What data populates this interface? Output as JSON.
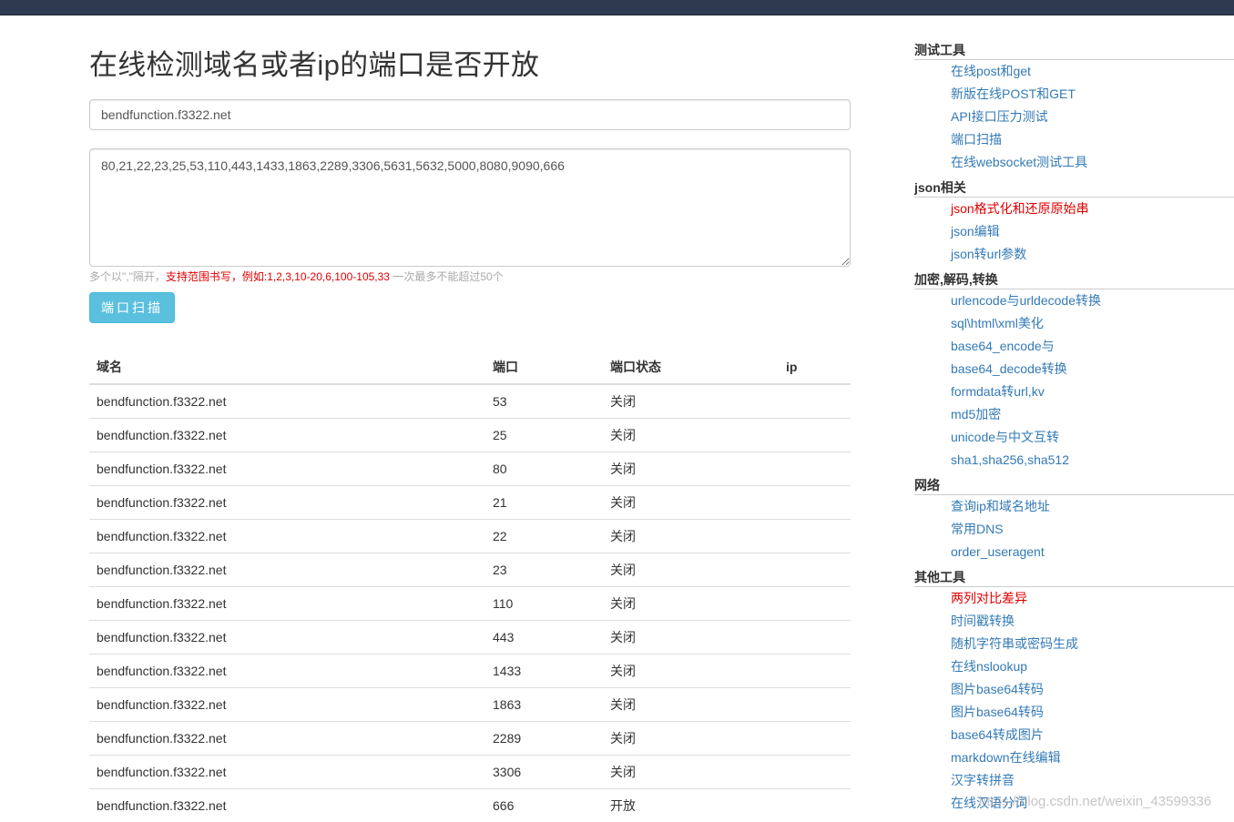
{
  "page": {
    "title": "在线检测域名或者ip的端口是否开放"
  },
  "form": {
    "host_value": "bendfunction.f3322.net",
    "ports_value": "80,21,22,23,25,53,110,443,1433,1863,2289,3306,5631,5632,5000,8080,9090,666",
    "hint_prefix": "多个以\",\"隔开，",
    "hint_red": "支持范围书写，例如:1,2,3,10-20,6,100-105,33",
    "hint_suffix": " 一次最多不能超过50个",
    "scan_button_label": "端口扫描"
  },
  "table": {
    "headers": [
      "域名",
      "端口",
      "端口状态",
      "ip"
    ],
    "rows": [
      {
        "domain": "bendfunction.f3322.net",
        "port": "53",
        "status": "关闭",
        "ip": ""
      },
      {
        "domain": "bendfunction.f3322.net",
        "port": "25",
        "status": "关闭",
        "ip": ""
      },
      {
        "domain": "bendfunction.f3322.net",
        "port": "80",
        "status": "关闭",
        "ip": ""
      },
      {
        "domain": "bendfunction.f3322.net",
        "port": "21",
        "status": "关闭",
        "ip": ""
      },
      {
        "domain": "bendfunction.f3322.net",
        "port": "22",
        "status": "关闭",
        "ip": ""
      },
      {
        "domain": "bendfunction.f3322.net",
        "port": "23",
        "status": "关闭",
        "ip": ""
      },
      {
        "domain": "bendfunction.f3322.net",
        "port": "110",
        "status": "关闭",
        "ip": ""
      },
      {
        "domain": "bendfunction.f3322.net",
        "port": "443",
        "status": "关闭",
        "ip": ""
      },
      {
        "domain": "bendfunction.f3322.net",
        "port": "1433",
        "status": "关闭",
        "ip": ""
      },
      {
        "domain": "bendfunction.f3322.net",
        "port": "1863",
        "status": "关闭",
        "ip": ""
      },
      {
        "domain": "bendfunction.f3322.net",
        "port": "2289",
        "status": "关闭",
        "ip": ""
      },
      {
        "domain": "bendfunction.f3322.net",
        "port": "3306",
        "status": "关闭",
        "ip": ""
      },
      {
        "domain": "bendfunction.f3322.net",
        "port": "666",
        "status": "开放",
        "ip": ""
      }
    ]
  },
  "sidebar": {
    "sections": [
      {
        "heading": "测试工具",
        "links": [
          {
            "label": "在线post和get",
            "hot": false
          },
          {
            "label": "新版在线POST和GET",
            "hot": false
          },
          {
            "label": "API接口压力测试",
            "hot": false
          },
          {
            "label": "端口扫描",
            "hot": false
          },
          {
            "label": "在线websocket测试工具",
            "hot": false
          }
        ]
      },
      {
        "heading": "json相关",
        "links": [
          {
            "label": "json格式化和还原原始串",
            "hot": true
          },
          {
            "label": "json编辑",
            "hot": false
          },
          {
            "label": "json转url参数",
            "hot": false
          }
        ]
      },
      {
        "heading": "加密,解码,转换",
        "links": [
          {
            "label": "urlencode与urldecode转换",
            "hot": false
          },
          {
            "label": "sql\\html\\xml美化",
            "hot": false
          },
          {
            "label": "base64_encode与",
            "hot": false
          },
          {
            "label": "base64_decode转换",
            "hot": false
          },
          {
            "label": "formdata转url,kv",
            "hot": false
          },
          {
            "label": "md5加密",
            "hot": false
          },
          {
            "label": "unicode与中文互转",
            "hot": false
          },
          {
            "label": "sha1,sha256,sha512",
            "hot": false
          }
        ]
      },
      {
        "heading": "网络",
        "links": [
          {
            "label": "查询ip和域名地址",
            "hot": false
          },
          {
            "label": "常用DNS",
            "hot": false
          },
          {
            "label": "order_useragent",
            "hot": false
          }
        ]
      },
      {
        "heading": "其他工具",
        "links": [
          {
            "label": "两列对比差异",
            "hot": true
          },
          {
            "label": "时间戳转换",
            "hot": false
          },
          {
            "label": "随机字符串或密码生成",
            "hot": false
          },
          {
            "label": "在线nslookup",
            "hot": false
          },
          {
            "label": "图片base64转码",
            "hot": false
          },
          {
            "label": "图片base64转码",
            "hot": false
          },
          {
            "label": "base64转成图片",
            "hot": false
          },
          {
            "label": "markdown在线编辑",
            "hot": false
          },
          {
            "label": "汉字转拼音",
            "hot": false
          },
          {
            "label": "在线汉语分词",
            "hot": false
          }
        ]
      }
    ]
  },
  "watermark": "https://blog.csdn.net/weixin_43599336",
  "colors": {
    "topbar": "#2e3a50",
    "link": "#337ab7",
    "hot": "#e00000",
    "button": "#5bc0de"
  }
}
